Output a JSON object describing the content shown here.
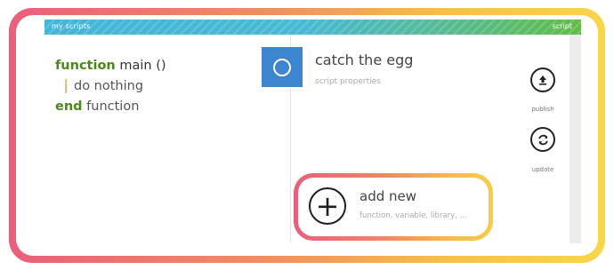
{
  "titlebar": {
    "app_name": "my scripts",
    "right_label": "script"
  },
  "code": {
    "line1": {
      "keyword": "function",
      "name": "main ()"
    },
    "line2": {
      "statement": "do nothing"
    },
    "line3": {
      "keyword": "end",
      "rest": "function"
    }
  },
  "script": {
    "title": "catch the egg",
    "subtitle": "script properties"
  },
  "actions": {
    "publish_label": "publish",
    "update_label": "update"
  },
  "add_new": {
    "title": "add new",
    "subtitle": "function, variable, library, ..."
  },
  "colors": {
    "titlebar_start": "#42b6d9",
    "titlebar_end": "#61bc48",
    "script_tile": "#3d85cf",
    "keyword": "#4b8a17",
    "highlight_start": "#e85f7b",
    "highlight_end": "#f8d64a"
  },
  "icons": {
    "script": "circle-icon",
    "publish": "upload-icon",
    "update": "refresh-icon",
    "add": "plus-icon"
  }
}
